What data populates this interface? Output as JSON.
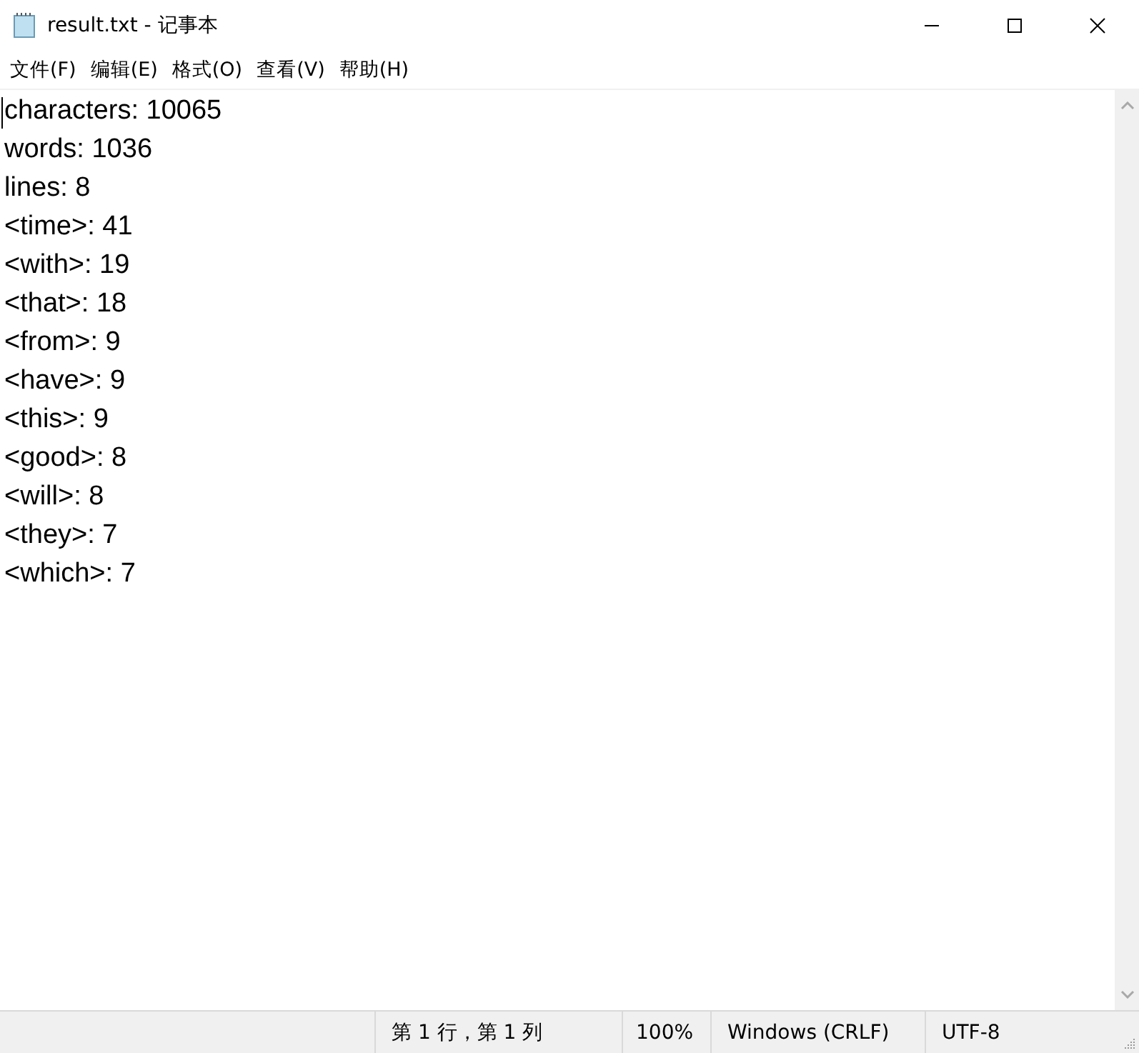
{
  "window": {
    "title": "result.txt - 记事本"
  },
  "menu": [
    "文件(F)",
    "编辑(E)",
    "格式(O)",
    "查看(V)",
    "帮助(H)"
  ],
  "editor": {
    "lines": [
      "characters: 10065",
      "words: 1036",
      "lines: 8",
      "<time>: 41",
      "<with>: 19",
      "<that>: 18",
      "<from>: 9",
      "<have>: 9",
      "<this>: 9",
      "<good>: 8",
      "<will>: 8",
      "<they>: 7",
      "<which>: 7"
    ]
  },
  "status_bar": [
    "第 1 行，第 1 列",
    "100%",
    "Windows (CRLF)",
    "UTF-8"
  ]
}
